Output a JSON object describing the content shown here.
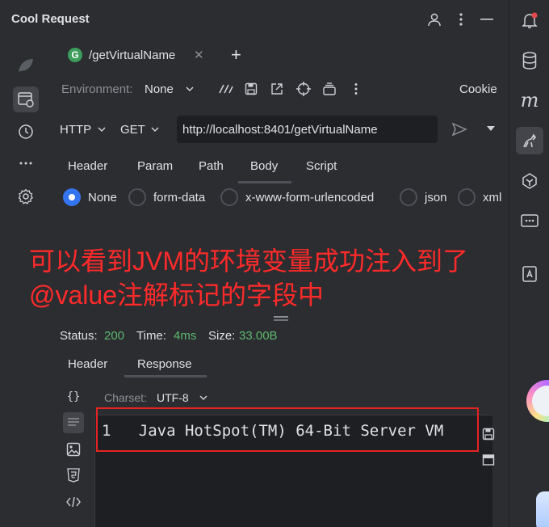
{
  "app": {
    "title": "Cool Request"
  },
  "request_tab": {
    "icon_letter": "G",
    "label": "/getVirtualName"
  },
  "environment": {
    "label": "Environment:",
    "value": "None"
  },
  "toolbar": {
    "cookie_label": "Cookie"
  },
  "request": {
    "protocol": "HTTP",
    "method": "GET",
    "url": "http://localhost:8401/getVirtualName"
  },
  "request_tabs": [
    "Header",
    "Param",
    "Path",
    "Body",
    "Script"
  ],
  "body_types": [
    "None",
    "form-data",
    "x-www-form-urlencoded",
    "json",
    "xml"
  ],
  "annotation": {
    "line1": "可以看到JVM的环境变量成功注入到了",
    "line2": "@value注解标记的字段中",
    "color": "#ff2a2a"
  },
  "status": {
    "status_label": "Status:",
    "status_value": "200",
    "time_label": "Time:",
    "time_value": "4ms",
    "size_label": "Size:",
    "size_value": "33.00B"
  },
  "response_tabs": [
    "Header",
    "Response"
  ],
  "response": {
    "charset_label": "Charset:",
    "charset_value": "UTF-8",
    "line_number": "1",
    "line_text": "Java HotSpot(TM) 64-Bit Server VM"
  },
  "colors": {
    "accent": "#3574f0",
    "success": "#5fb86f",
    "highlight_box": "#e52323"
  }
}
